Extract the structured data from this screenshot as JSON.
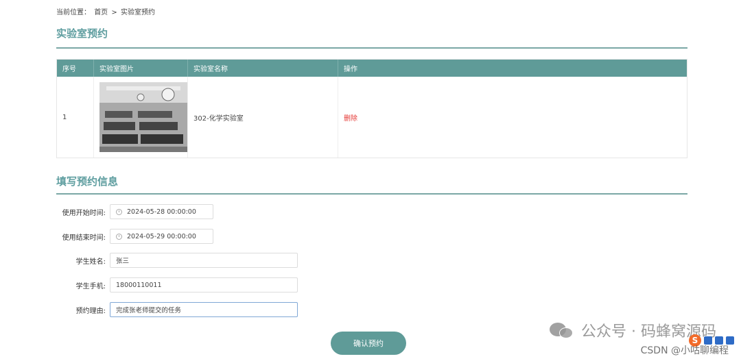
{
  "breadcrumb": {
    "prefix": "当前位置：",
    "home": "首页",
    "sep": ">",
    "current": "实验室预约"
  },
  "page_title": "实验室预约",
  "table": {
    "headers": [
      "序号",
      "实验室图片",
      "实验室名称",
      "操作"
    ],
    "rows": [
      {
        "index": "1",
        "name": "302-化学实验室",
        "action": "删除"
      }
    ]
  },
  "form_title": "填写预约信息",
  "form": {
    "start_label": "使用开始时间:",
    "start_value": "2024-05-28 00:00:00",
    "end_label": "使用结束时间:",
    "end_value": "2024-05-29 00:00:00",
    "name_label": "学生姓名:",
    "name_value": "张三",
    "phone_label": "学生手机:",
    "phone_value": "18000110011",
    "reason_label": "预约理由:",
    "reason_value": "完成张老师提交的任务"
  },
  "submit_label": "确认预约",
  "watermark": {
    "text": "公众号 · 码蜂窝源码",
    "csdn": "CSDN @小咕聊编程"
  },
  "colors": {
    "accent": "#5f9b98",
    "danger": "#e53935"
  }
}
